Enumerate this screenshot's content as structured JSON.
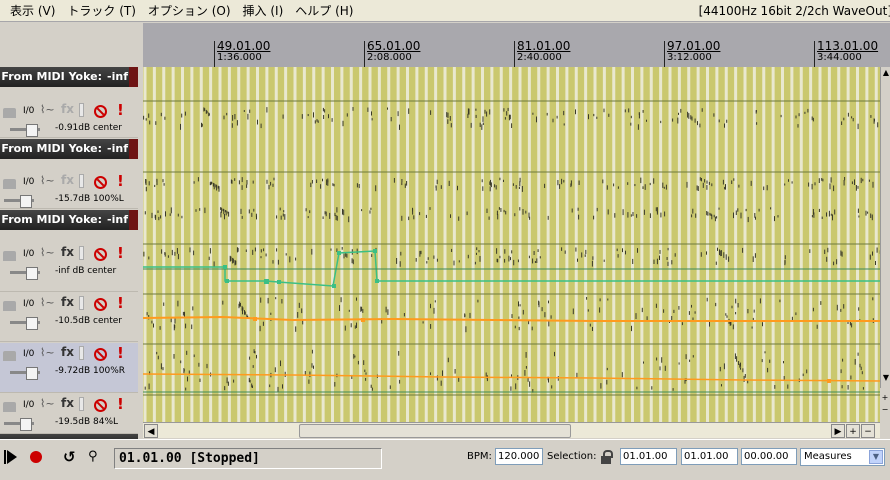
{
  "menu": [
    "表示 (V)",
    "トラック (T)",
    "オプション (O)",
    "挿入 (I)",
    "ヘルプ (H)"
  ],
  "audio_status": "[44100Hz 16bit 2/2ch WaveOut]",
  "ruler": [
    {
      "measure": "49.01.00",
      "time": "1:36.000"
    },
    {
      "measure": "65.01.00",
      "time": "2:08.000"
    },
    {
      "measure": "81.01.00",
      "time": "2:40.000"
    },
    {
      "measure": "97.01.00",
      "time": "3:12.000"
    },
    {
      "measure": "113.01.00",
      "time": "3:44.000"
    }
  ],
  "tracks": [
    {
      "kind": "name",
      "label": "n From MIDI Yoke:",
      "vol": "-inf"
    },
    {
      "kind": "ctrl",
      "io": "I/0",
      "fx": "fx",
      "volume": "-0.91dB center",
      "fx_active": false,
      "selected": false
    },
    {
      "kind": "name",
      "label": "n From MIDI Yoke:",
      "vol": "-inf"
    },
    {
      "kind": "ctrl",
      "io": "I/0",
      "fx": "fx",
      "volume": "-15.7dB 100%L",
      "fx_active": false,
      "selected": false
    },
    {
      "kind": "name",
      "label": "n From MIDI Yoke:",
      "vol": "-inf"
    },
    {
      "kind": "ctrl",
      "io": "I/0",
      "fx": "fx",
      "volume": "-inf dB center",
      "fx_active": true,
      "selected": false
    },
    {
      "kind": "ctrl",
      "io": "I/0",
      "fx": "fx",
      "volume": "-10.5dB center",
      "fx_active": true,
      "selected": false
    },
    {
      "kind": "ctrl",
      "io": "I/0",
      "fx": "fx",
      "volume": "-9.72dB 100%R",
      "fx_active": true,
      "selected": true
    },
    {
      "kind": "ctrl",
      "io": "I/0",
      "fx": "fx",
      "volume": "-19.5dB 84%L",
      "fx_active": true,
      "selected": false
    }
  ],
  "transport": {
    "position": "01.01.00 [Stopped]",
    "bpm_label": "BPM:",
    "bpm": "120.000",
    "selection_label": "Selection:",
    "sel_start": "01.01.00",
    "sel_end": "01.01.00",
    "sel_length": "00.00.00",
    "time_mode": "Measures"
  },
  "colors": {
    "lane_bg": "#cac86e",
    "grid": "#e9e8cf",
    "envelope_green": "#3bbf85",
    "envelope_orange": "#ff9a1e",
    "arm_red": "#cc0000"
  }
}
